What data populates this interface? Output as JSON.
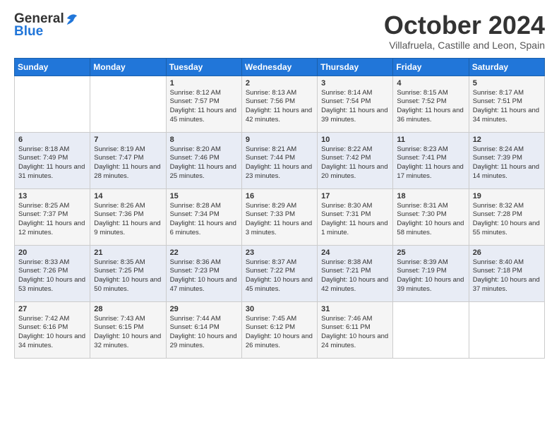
{
  "logo": {
    "general": "General",
    "blue": "Blue"
  },
  "header": {
    "month": "October 2024",
    "location": "Villafruela, Castille and Leon, Spain"
  },
  "days_of_week": [
    "Sunday",
    "Monday",
    "Tuesday",
    "Wednesday",
    "Thursday",
    "Friday",
    "Saturday"
  ],
  "weeks": [
    [
      {
        "day": "",
        "info": ""
      },
      {
        "day": "",
        "info": ""
      },
      {
        "day": "1",
        "info": "Sunrise: 8:12 AM\nSunset: 7:57 PM\nDaylight: 11 hours and 45 minutes."
      },
      {
        "day": "2",
        "info": "Sunrise: 8:13 AM\nSunset: 7:56 PM\nDaylight: 11 hours and 42 minutes."
      },
      {
        "day": "3",
        "info": "Sunrise: 8:14 AM\nSunset: 7:54 PM\nDaylight: 11 hours and 39 minutes."
      },
      {
        "day": "4",
        "info": "Sunrise: 8:15 AM\nSunset: 7:52 PM\nDaylight: 11 hours and 36 minutes."
      },
      {
        "day": "5",
        "info": "Sunrise: 8:17 AM\nSunset: 7:51 PM\nDaylight: 11 hours and 34 minutes."
      }
    ],
    [
      {
        "day": "6",
        "info": "Sunrise: 8:18 AM\nSunset: 7:49 PM\nDaylight: 11 hours and 31 minutes."
      },
      {
        "day": "7",
        "info": "Sunrise: 8:19 AM\nSunset: 7:47 PM\nDaylight: 11 hours and 28 minutes."
      },
      {
        "day": "8",
        "info": "Sunrise: 8:20 AM\nSunset: 7:46 PM\nDaylight: 11 hours and 25 minutes."
      },
      {
        "day": "9",
        "info": "Sunrise: 8:21 AM\nSunset: 7:44 PM\nDaylight: 11 hours and 23 minutes."
      },
      {
        "day": "10",
        "info": "Sunrise: 8:22 AM\nSunset: 7:42 PM\nDaylight: 11 hours and 20 minutes."
      },
      {
        "day": "11",
        "info": "Sunrise: 8:23 AM\nSunset: 7:41 PM\nDaylight: 11 hours and 17 minutes."
      },
      {
        "day": "12",
        "info": "Sunrise: 8:24 AM\nSunset: 7:39 PM\nDaylight: 11 hours and 14 minutes."
      }
    ],
    [
      {
        "day": "13",
        "info": "Sunrise: 8:25 AM\nSunset: 7:37 PM\nDaylight: 11 hours and 12 minutes."
      },
      {
        "day": "14",
        "info": "Sunrise: 8:26 AM\nSunset: 7:36 PM\nDaylight: 11 hours and 9 minutes."
      },
      {
        "day": "15",
        "info": "Sunrise: 8:28 AM\nSunset: 7:34 PM\nDaylight: 11 hours and 6 minutes."
      },
      {
        "day": "16",
        "info": "Sunrise: 8:29 AM\nSunset: 7:33 PM\nDaylight: 11 hours and 3 minutes."
      },
      {
        "day": "17",
        "info": "Sunrise: 8:30 AM\nSunset: 7:31 PM\nDaylight: 11 hours and 1 minute."
      },
      {
        "day": "18",
        "info": "Sunrise: 8:31 AM\nSunset: 7:30 PM\nDaylight: 10 hours and 58 minutes."
      },
      {
        "day": "19",
        "info": "Sunrise: 8:32 AM\nSunset: 7:28 PM\nDaylight: 10 hours and 55 minutes."
      }
    ],
    [
      {
        "day": "20",
        "info": "Sunrise: 8:33 AM\nSunset: 7:26 PM\nDaylight: 10 hours and 53 minutes."
      },
      {
        "day": "21",
        "info": "Sunrise: 8:35 AM\nSunset: 7:25 PM\nDaylight: 10 hours and 50 minutes."
      },
      {
        "day": "22",
        "info": "Sunrise: 8:36 AM\nSunset: 7:23 PM\nDaylight: 10 hours and 47 minutes."
      },
      {
        "day": "23",
        "info": "Sunrise: 8:37 AM\nSunset: 7:22 PM\nDaylight: 10 hours and 45 minutes."
      },
      {
        "day": "24",
        "info": "Sunrise: 8:38 AM\nSunset: 7:21 PM\nDaylight: 10 hours and 42 minutes."
      },
      {
        "day": "25",
        "info": "Sunrise: 8:39 AM\nSunset: 7:19 PM\nDaylight: 10 hours and 39 minutes."
      },
      {
        "day": "26",
        "info": "Sunrise: 8:40 AM\nSunset: 7:18 PM\nDaylight: 10 hours and 37 minutes."
      }
    ],
    [
      {
        "day": "27",
        "info": "Sunrise: 7:42 AM\nSunset: 6:16 PM\nDaylight: 10 hours and 34 minutes."
      },
      {
        "day": "28",
        "info": "Sunrise: 7:43 AM\nSunset: 6:15 PM\nDaylight: 10 hours and 32 minutes."
      },
      {
        "day": "29",
        "info": "Sunrise: 7:44 AM\nSunset: 6:14 PM\nDaylight: 10 hours and 29 minutes."
      },
      {
        "day": "30",
        "info": "Sunrise: 7:45 AM\nSunset: 6:12 PM\nDaylight: 10 hours and 26 minutes."
      },
      {
        "day": "31",
        "info": "Sunrise: 7:46 AM\nSunset: 6:11 PM\nDaylight: 10 hours and 24 minutes."
      },
      {
        "day": "",
        "info": ""
      },
      {
        "day": "",
        "info": ""
      }
    ]
  ]
}
